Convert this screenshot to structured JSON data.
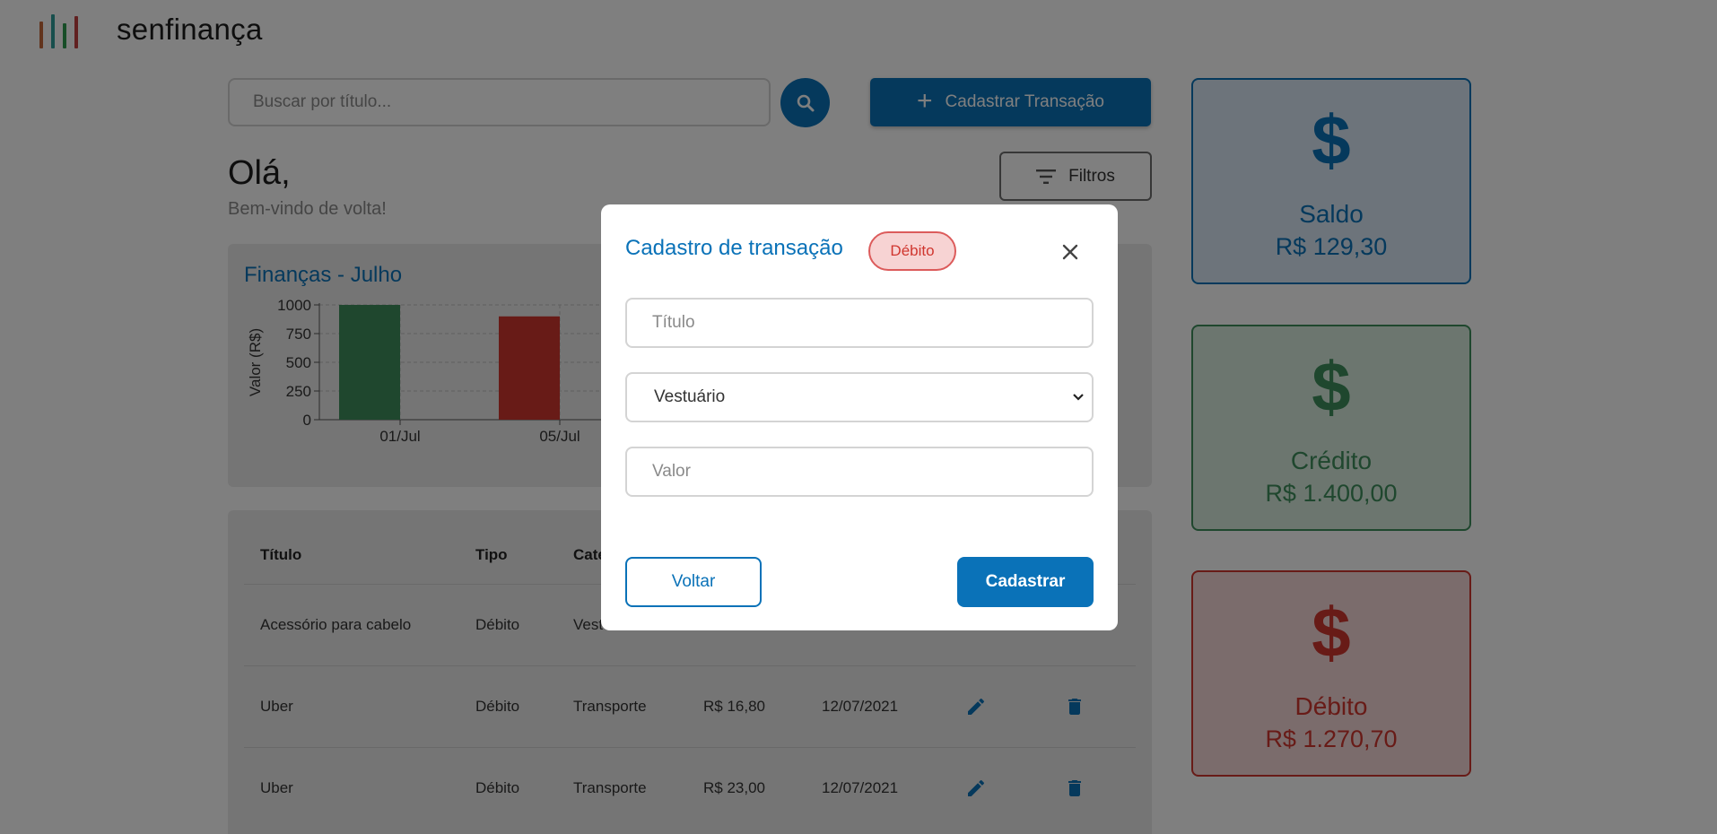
{
  "header": {
    "brand": "senfinança"
  },
  "search": {
    "placeholder": "Buscar por título..."
  },
  "actions": {
    "add_label": "Cadastrar Transação",
    "filter_label": "Filtros"
  },
  "greeting": {
    "title": "Olá,",
    "subtitle": "Bem-vindo de volta!"
  },
  "colors": {
    "primary": "#0a72b8",
    "credit": "#3e8e5c",
    "debit": "#d0362f",
    "logo": [
      "#c5683a",
      "#2f9e9b",
      "#2e9a4e",
      "#c24040"
    ]
  },
  "chart_data": {
    "type": "bar",
    "title": "Finanças - Julho",
    "xlabel": "",
    "ylabel": "Valor (R$)",
    "ylim": [
      0,
      1000
    ],
    "yticks": [
      0,
      250,
      500,
      750,
      1000
    ],
    "categories": [
      "01/Jul",
      "05/Jul"
    ],
    "series": [
      {
        "color": "#3e8e5c",
        "values": [
          1000,
          0
        ]
      },
      {
        "color": "#d0362f",
        "values": [
          0,
          900
        ]
      }
    ],
    "grid": true
  },
  "table": {
    "headers": [
      "Título",
      "Tipo",
      "Cate"
    ],
    "rows": [
      {
        "titulo": "Acessório para cabelo",
        "tipo": "Débito",
        "categoria": "Vest",
        "valor": "",
        "data": ""
      },
      {
        "titulo": "Uber",
        "tipo": "Débito",
        "categoria": "Transporte",
        "valor": "R$ 16,80",
        "data": "12/07/2021"
      },
      {
        "titulo": "Uber",
        "tipo": "Débito",
        "categoria": "Transporte",
        "valor": "R$ 23,00",
        "data": "12/07/2021"
      }
    ]
  },
  "summary": [
    {
      "symbol": "$",
      "label": "Saldo",
      "value": "R$ 129,30"
    },
    {
      "symbol": "$",
      "label": "Crédito",
      "value": "R$ 1.400,00"
    },
    {
      "symbol": "$",
      "label": "Débito",
      "value": "R$ 1.270,70"
    }
  ],
  "modal": {
    "title": "Cadastro de transação",
    "badge": "Débito",
    "title_placeholder": "Título",
    "category_value": "Vestuário",
    "value_placeholder": "Valor",
    "back_label": "Voltar",
    "submit_label": "Cadastrar"
  }
}
